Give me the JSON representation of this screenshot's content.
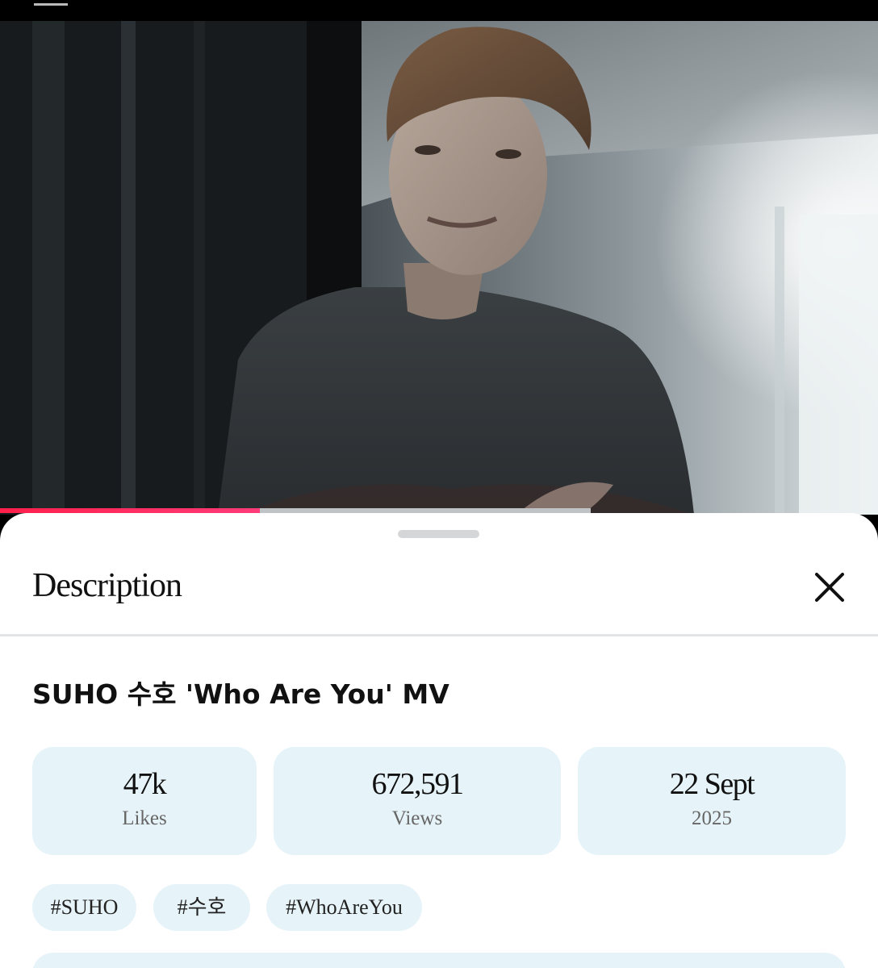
{
  "video": {
    "progress_played": 0.296,
    "progress_buffered": 0.673
  },
  "sheet": {
    "title": "Description",
    "close_icon": "close-icon"
  },
  "details": {
    "video_title": "SUHO 수호 'Who Are You' MV",
    "stats": [
      {
        "value": "47k",
        "label": "Likes"
      },
      {
        "value": "672,591",
        "label": "Views"
      },
      {
        "value": "22 Sept",
        "label": "2025"
      }
    ],
    "tags": [
      "#SUHO",
      "#수호",
      "#WhoAreYou"
    ]
  },
  "colors": {
    "accent": "#ff2a5c",
    "card_bg": "#e6f3f8"
  }
}
